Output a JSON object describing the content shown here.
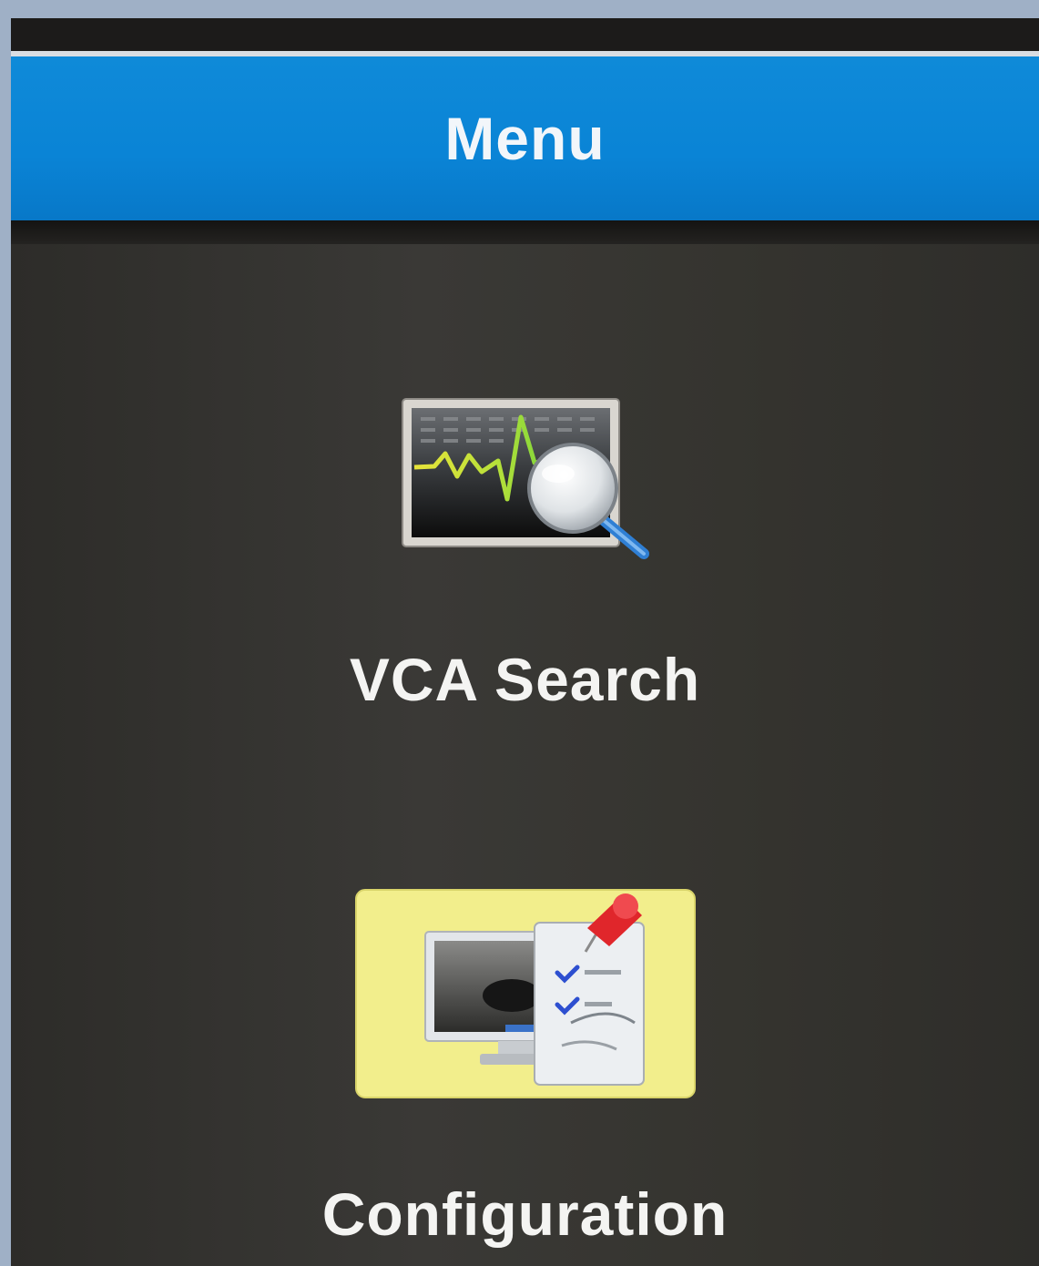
{
  "header": {
    "title": "Menu"
  },
  "menu": {
    "items": [
      {
        "label": "VCA Search",
        "icon": "vca-search-icon"
      },
      {
        "label": "Configuration",
        "icon": "configuration-icon"
      }
    ]
  },
  "colors": {
    "title_bar": "#0a84d6",
    "background": "#2b2a28",
    "text": "#f4f4f2",
    "config_icon_bg": "#f2ee8c"
  }
}
